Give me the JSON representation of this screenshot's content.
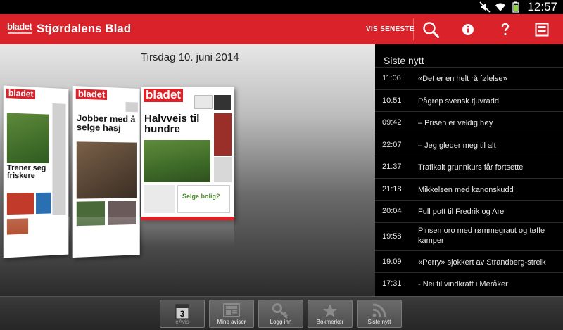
{
  "status": {
    "time": "12:57"
  },
  "header": {
    "logo_text": "bladet",
    "title": "Stjørdalens Blad",
    "vis_seneste": "VIS SENESTE",
    "actions": [
      "search-icon",
      "info-icon",
      "help-icon",
      "layout-icon"
    ]
  },
  "main": {
    "date": "Tirsdag 10. juni 2014",
    "papers": [
      {
        "brand": "bladet",
        "headline": "Trener seg friskere"
      },
      {
        "brand": "bladet",
        "headline": "Jobber med å selge hasj"
      },
      {
        "brand": "bladet",
        "headline": "Halvveis til hundre",
        "callout": "Selge bolig?"
      }
    ]
  },
  "news": {
    "title": "Siste nytt",
    "items": [
      {
        "time": "11:06",
        "text": "«Det er en helt rå følelse»"
      },
      {
        "time": "10:51",
        "text": "Pågrep svensk tjuvradd"
      },
      {
        "time": "09:42",
        "text": "– Prisen er veldig høy"
      },
      {
        "time": "22:07",
        "text": "– Jeg gleder meg til alt"
      },
      {
        "time": "21:37",
        "text": "Trafikalt grunnkurs får fortsette"
      },
      {
        "time": "21:18",
        "text": "Mikkelsen med kanonskudd"
      },
      {
        "time": "20:04",
        "text": "Full pott til Fredrik og Are"
      },
      {
        "time": "19:58",
        "text": "Pinsemoro med rømmegraut og tøffe kamper"
      },
      {
        "time": "19:09",
        "text": "«Perry» sjokkert av Strandberg-streik"
      },
      {
        "time": "17:31",
        "text": "- Nei til vindkraft i Meråker"
      }
    ]
  },
  "bottom": {
    "tabs": [
      {
        "label": "eAvis",
        "icon": "calendar-icon",
        "badge": "3",
        "active": true
      },
      {
        "label": "Mine aviser",
        "icon": "newspaper-icon"
      },
      {
        "label": "Logg inn",
        "icon": "key-icon"
      },
      {
        "label": "Bokmerker",
        "icon": "star-icon"
      },
      {
        "label": "Siste nytt",
        "icon": "rss-icon"
      }
    ]
  },
  "colors": {
    "brand_red": "#d9222a",
    "list_bg": "#000000",
    "bar_bg": "#2e2e2e"
  }
}
